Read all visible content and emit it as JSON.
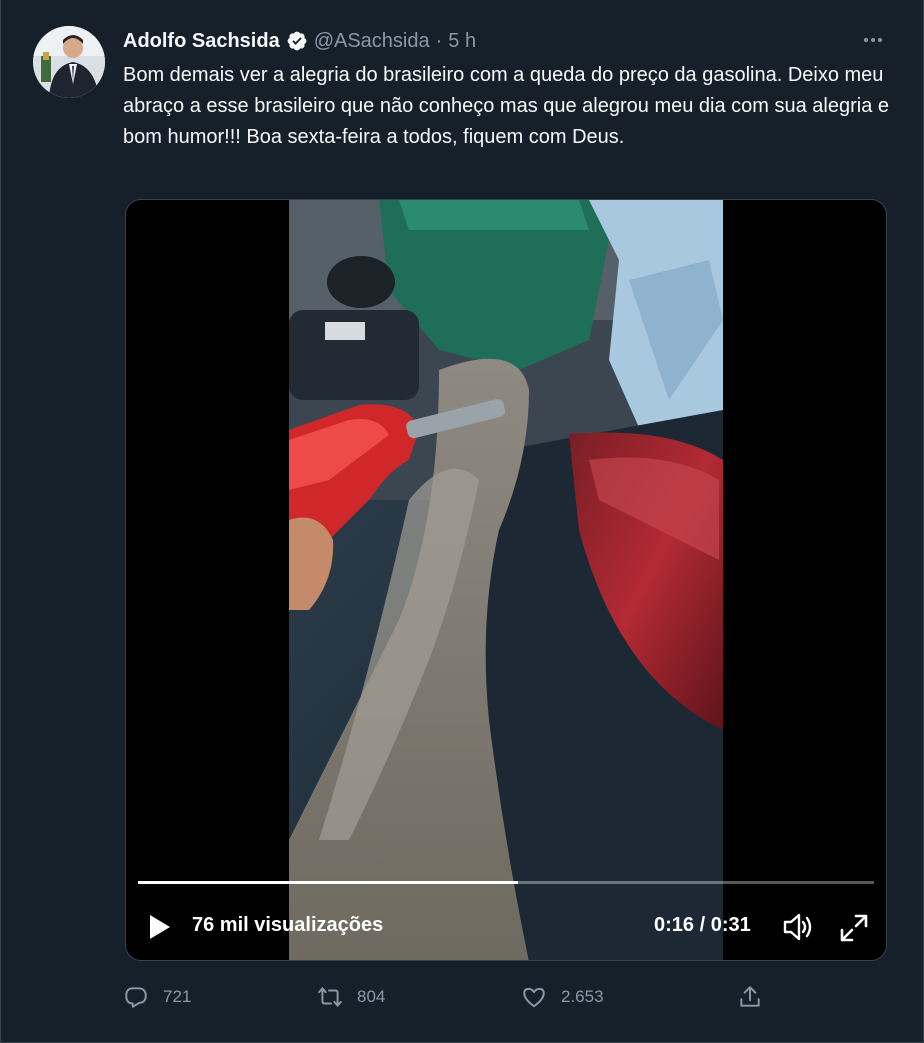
{
  "author": {
    "name": "Adolfo Sachsida",
    "handle": "@ASachsida",
    "separator": "·",
    "time": "5 h",
    "verified_icon": "verified-badge-icon"
  },
  "tweet": {
    "text": "Bom demais ver a alegria do brasileiro com a queda do preço da gasolina. Deixo meu abraço a esse brasileiro que não conheço mas que alegrou meu dia com sua alegria e bom humor!!! Boa sexta-feira a todos, fiquem com Deus."
  },
  "video": {
    "views": "76 mil visualizações",
    "timecode": "0:16 / 0:31",
    "progress_fraction": 0.516
  },
  "actions": {
    "reply_count": "721",
    "retweet_count": "804",
    "like_count": "2.653"
  },
  "colors": {
    "background": "#15202b",
    "text_primary": "#f7f9f9",
    "text_secondary": "#8b98a5",
    "verified": "#f7f9f9",
    "fuel_nozzle": "#d0272b"
  }
}
